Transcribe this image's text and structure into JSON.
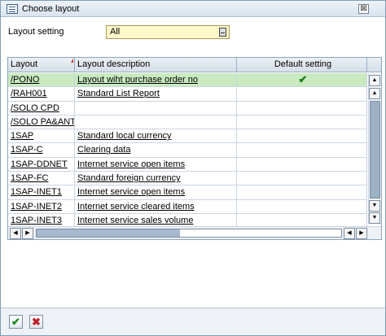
{
  "window": {
    "title": "Choose layout",
    "close_glyph": "⊠"
  },
  "setting": {
    "label": "Layout setting",
    "value": "All"
  },
  "grid": {
    "columns": [
      "Layout",
      "Layout description",
      "Default setting"
    ],
    "rows": [
      {
        "layout": "/PONO",
        "description": "Layout wiht purchase order no",
        "default": "✔"
      },
      {
        "layout": "/RAH001",
        "description": "Standard List Report",
        "default": ""
      },
      {
        "layout": "/SOLO CPD",
        "description": "",
        "default": ""
      },
      {
        "layout": "/SOLO PA&ANT",
        "description": "",
        "default": ""
      },
      {
        "layout": "1SAP",
        "description": "Standard local currency",
        "default": ""
      },
      {
        "layout": "1SAP-C",
        "description": "Clearing data",
        "default": ""
      },
      {
        "layout": "1SAP-DDNET",
        "description": "Internet service open items",
        "default": ""
      },
      {
        "layout": "1SAP-FC",
        "description": "Standard foreign currency",
        "default": ""
      },
      {
        "layout": "1SAP-INET1",
        "description": "Internet service open items",
        "default": ""
      },
      {
        "layout": "1SAP-INET2",
        "description": "Internet service cleared items",
        "default": ""
      },
      {
        "layout": "1SAP-INET3",
        "description": "Internet service sales volume",
        "default": ""
      }
    ]
  },
  "buttons": {
    "ok": "✔",
    "cancel": "✖"
  },
  "scroll": {
    "up": "▲",
    "down": "▼",
    "left": "◀",
    "right": "▶"
  },
  "colors": {
    "selected_row": "#c9eac0",
    "field_bg": "#fdf7c9"
  }
}
